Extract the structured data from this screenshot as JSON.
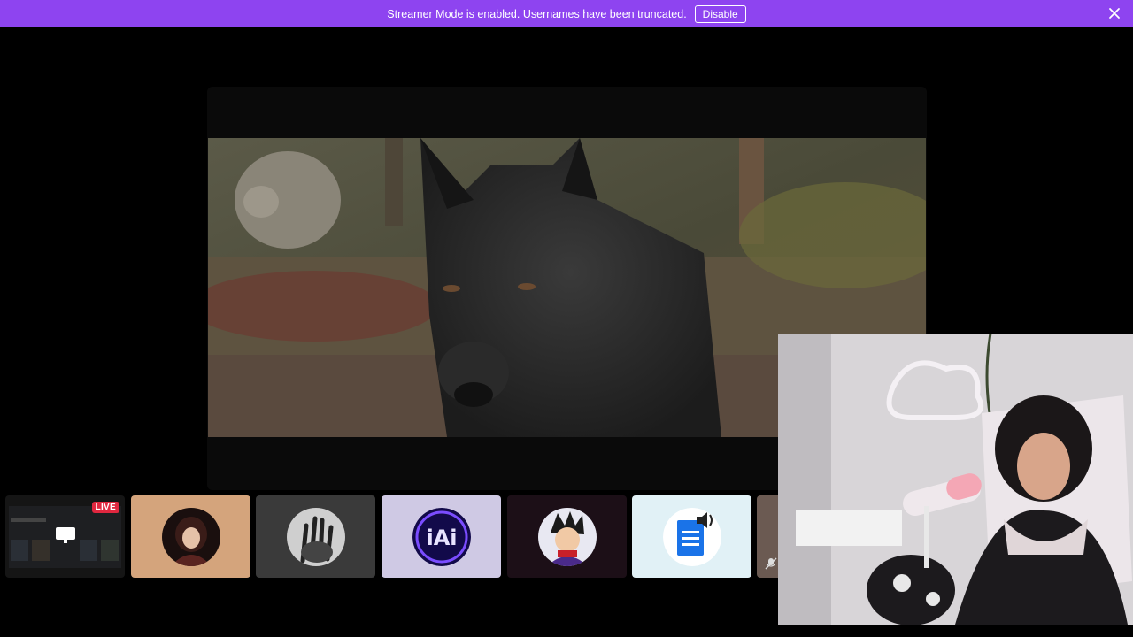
{
  "banner": {
    "message": "Streamer Mode is enabled. Usernames have been truncated.",
    "disable_label": "Disable",
    "background": "#8e44f0"
  },
  "strip": {
    "live_label": "LIVE",
    "tiles": [
      {
        "icon": "screen-share-icon",
        "background": "#1a1a1a"
      },
      {
        "icon": "anime-avatar",
        "background": "#d4a47c"
      },
      {
        "icon": "hand-avatar",
        "background": "#3a3a3a"
      },
      {
        "icon": "iai-logo-avatar",
        "background": "#cfc9e4"
      },
      {
        "icon": "anime-character-avatar",
        "background": "#1c0f17"
      },
      {
        "icon": "tts-document-avatar",
        "background": "#e1f1f6"
      }
    ]
  }
}
